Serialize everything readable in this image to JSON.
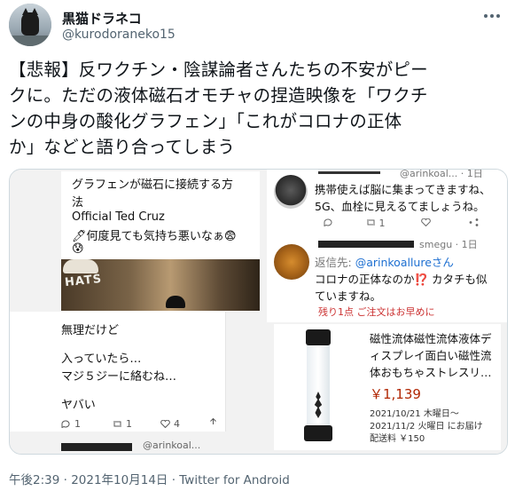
{
  "user": {
    "name": "黒猫ドラネコ",
    "handle": "@kurodoraneko15"
  },
  "tweet": {
    "lines": [
      "【悲報】反ワクチン・陰謀論者さんたちの不安がピー",
      "クに。ただの液体磁石オモチャの捏造映像を「ワクチ",
      "ンの中身の酸化グラフェン」「これがコロナの正体",
      "か」などと語り合ってしまう"
    ]
  },
  "media": {
    "left": {
      "card_lines": [
        "グラフェンが磁石に接続する方",
        "法",
        "Official Ted Cruz",
        "🖊何度見ても気持ち悪いなぁ😨",
        "😰"
      ],
      "photo_caption": "HATS",
      "body_lines": [
        "無理だけど",
        "入っていたら…",
        "マジ５ジーに絡むね…",
        "ヤバい"
      ],
      "counts": {
        "reply": "1",
        "retweet": "1",
        "like": "4"
      },
      "bottom_handle": "@arinkoal..."
    },
    "right": {
      "top_handle": "@arinkoal... · 1日",
      "reply1_lines": [
        "携帯使えば脳に集まってきますね、",
        "5G、血栓に見えるてましょうね。"
      ],
      "reply1_counts": {
        "reply": "",
        "retweet": "1",
        "like": ""
      },
      "reply2_header": "smegu · 1日",
      "reply2_to_label": "返信先: ",
      "reply2_to_handle": "@arinkoallureさん",
      "reply2_lines": [
        "コロナの正体なのか⁉️ カタチも似",
        "ていますね。"
      ],
      "cutoff_text": "残り1点 ご注文はお早めに",
      "product": {
        "title_lines": [
          "磁性流体磁性流体液体デ",
          "ィスプレイ面白い磁性流",
          "体おもちゃストレスリ…"
        ],
        "price": "￥1,139",
        "delivery_lines": [
          "2021/10/21 木曜日～",
          "2021/11/2 火曜日 にお届け",
          "配送料 ￥150"
        ]
      }
    }
  },
  "footer": {
    "meta": "午後2:39 · 2021年10月14日 · Twitter for Android"
  }
}
